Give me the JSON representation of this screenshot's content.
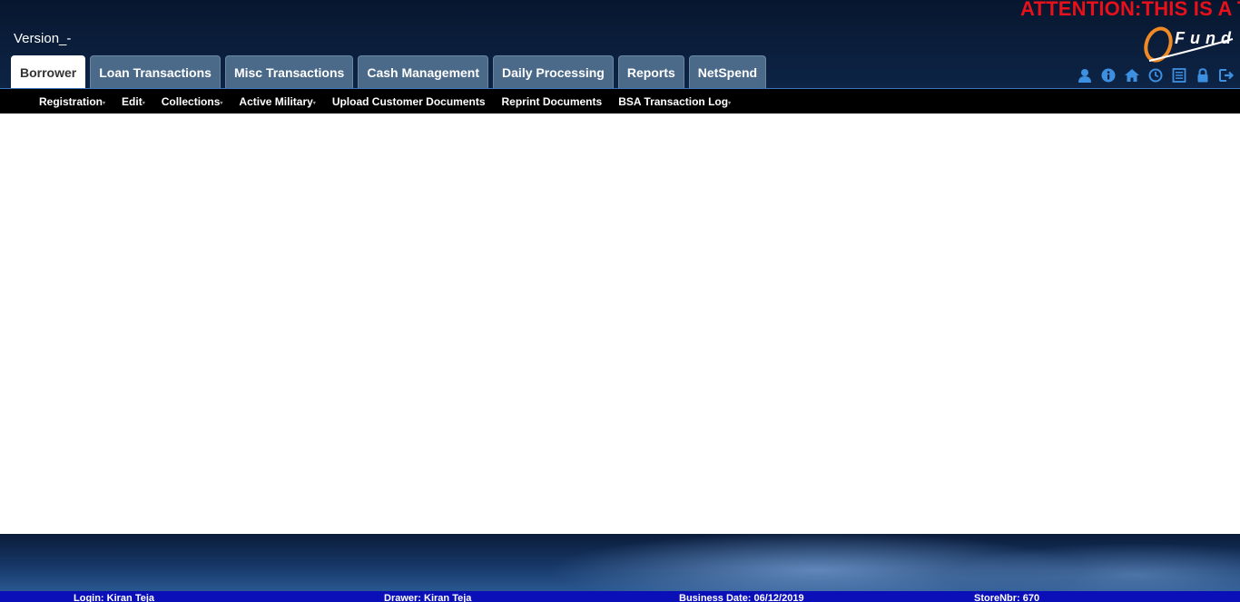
{
  "header": {
    "attention": "ATTENTION:THIS IS A T",
    "version": "Version_-",
    "logo_text": "Fund",
    "accent_color": "#f08a24"
  },
  "tabs": [
    {
      "label": "Borrower",
      "active": true
    },
    {
      "label": "Loan Transactions"
    },
    {
      "label": "Misc Transactions"
    },
    {
      "label": "Cash Management"
    },
    {
      "label": "Daily Processing"
    },
    {
      "label": "Reports"
    },
    {
      "label": "NetSpend"
    }
  ],
  "toolbar_icons": [
    "user-icon",
    "info-icon",
    "home-icon",
    "clock-icon",
    "list-icon",
    "lock-icon",
    "logout-icon"
  ],
  "subnav": [
    {
      "label": "Registration",
      "has_caret": true
    },
    {
      "label": "Edit",
      "has_caret": true
    },
    {
      "label": "Collections",
      "has_caret": true
    },
    {
      "label": "Active Military",
      "has_caret": true
    },
    {
      "label": "Upload Customer Documents"
    },
    {
      "label": "Reprint Documents"
    },
    {
      "label": "BSA Transaction Log",
      "has_caret": true
    }
  ],
  "status": {
    "login": "Login: Kiran Teja",
    "drawer": "Drawer: Kiran Teja",
    "business_date": "Business Date: 06/12/2019",
    "store": "StoreNbr: 670"
  }
}
